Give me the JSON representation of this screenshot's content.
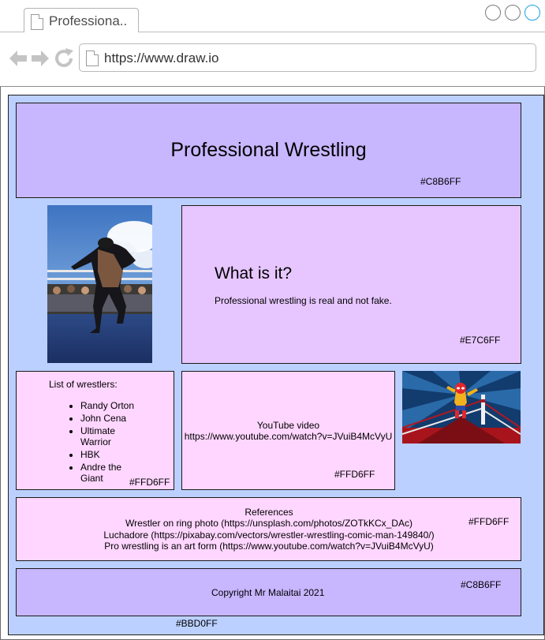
{
  "browser": {
    "tab_title": "Professiona..",
    "url": "https://www.draw.io"
  },
  "colors": {
    "canvas": "#BBD0FF",
    "panel_primary": "#C8B6FF",
    "panel_secondary": "#E7C6FF",
    "panel_tertiary": "#FFD6FF",
    "window_control_active": "#1BA1E2"
  },
  "header": {
    "title": "Professional Wrestling",
    "color_label": "#C8B6FF"
  },
  "intro": {
    "heading": "What is it?",
    "body": "Professional wrestling is real and not fake.",
    "color_label": "#E7C6FF"
  },
  "wrestlers": {
    "heading": "List of wrestlers:",
    "items": [
      "Randy Orton",
      "John Cena",
      "Ultimate Warrior",
      "HBK",
      "Andre the Giant"
    ],
    "color_label": "#FFD6FF"
  },
  "video": {
    "label": "YouTube video",
    "link": "https://www.youtube.com/watch?v=JVuiB4McVyU",
    "color_label": "#FFD6FF"
  },
  "references": {
    "heading": "References",
    "lines": [
      "Wrestler on ring photo (https://unsplash.com/photos/ZOTkKCx_DAc)",
      "Luchadore (https://pixabay.com/vectors/wrestler-wrestling-comic-man-149840/)",
      "Pro wrestling is an art form (https://www.youtube.com/watch?v=JVuiB4McVyU)"
    ],
    "color_label": "#FFD6FF"
  },
  "footer": {
    "copyright": "Copyright Mr Malaitai 2021",
    "color_label": "#C8B6FF"
  },
  "canvas": {
    "color_label": "#BBD0FF"
  }
}
